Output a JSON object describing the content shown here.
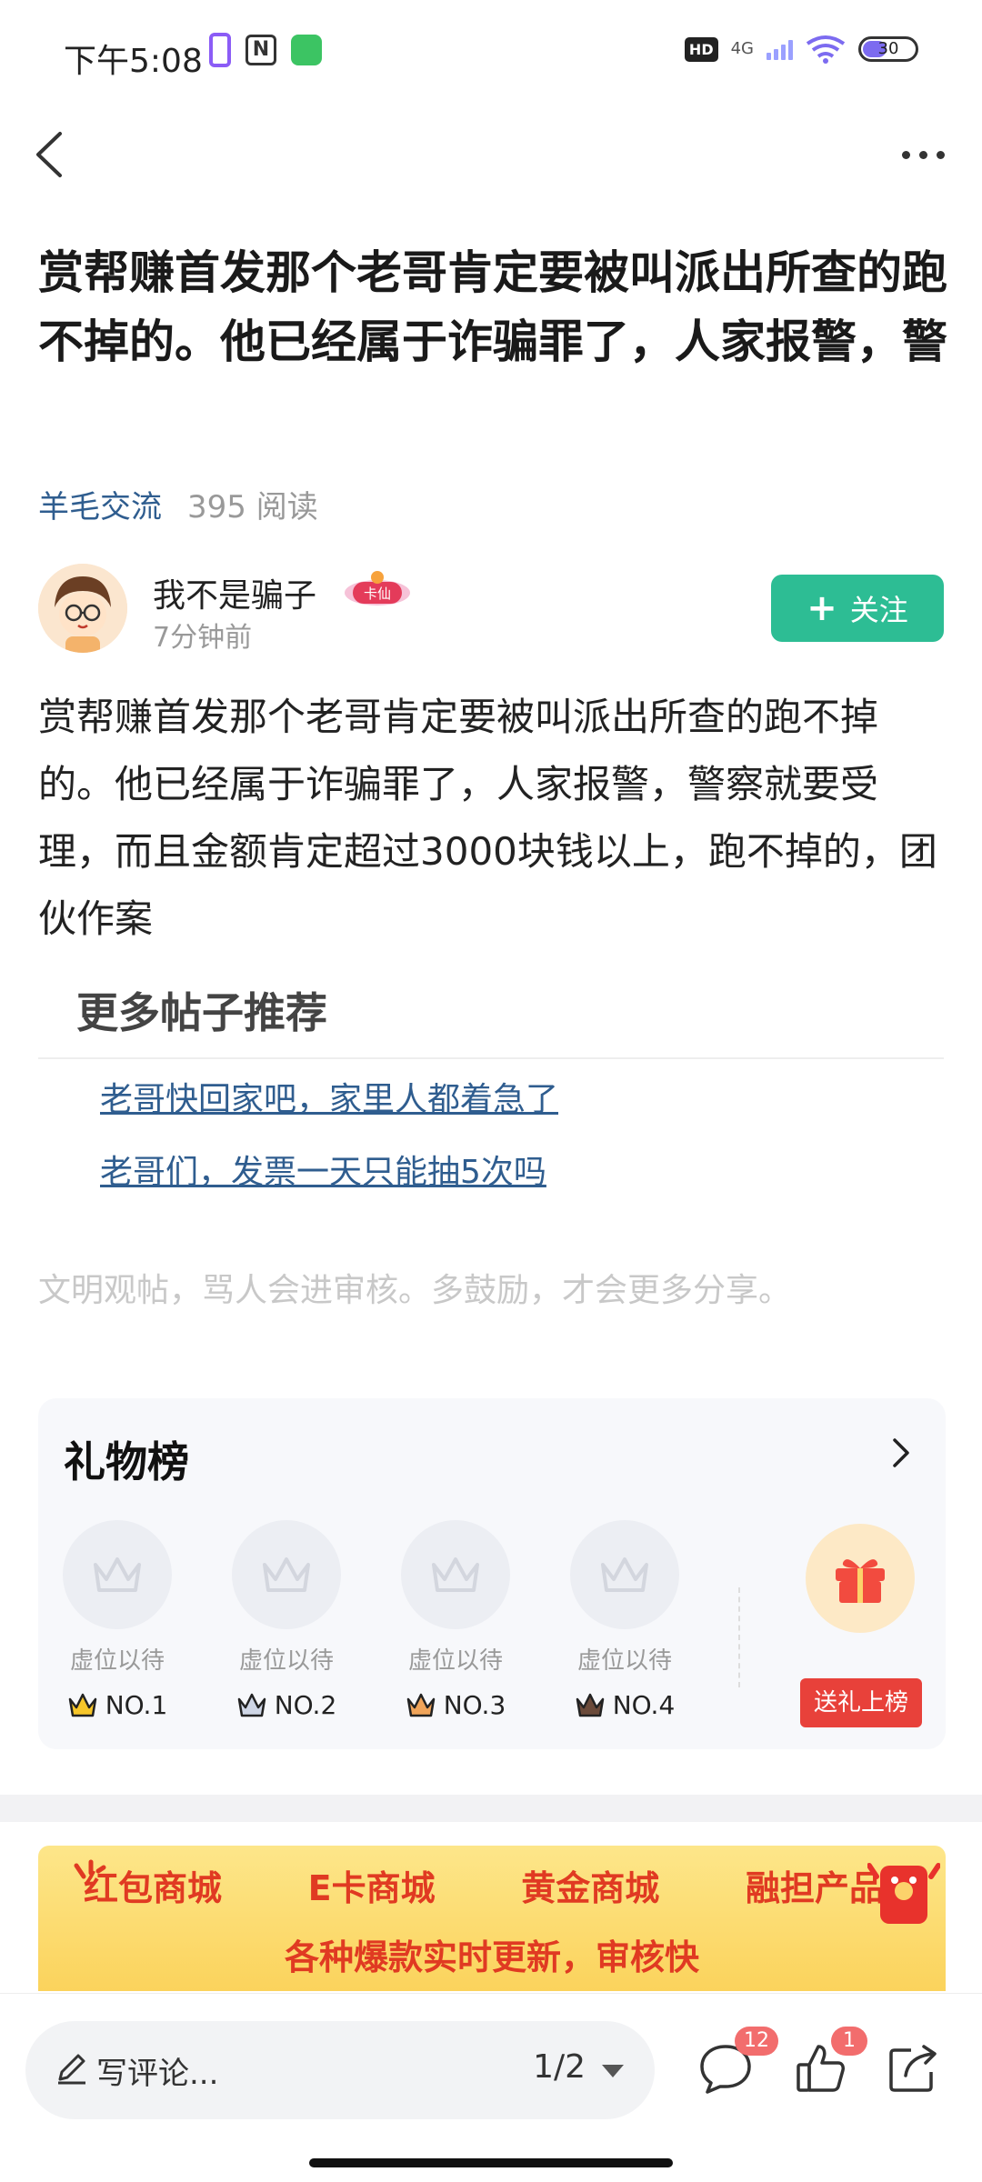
{
  "status_bar": {
    "time": "下午5:08",
    "network": "4G",
    "hd_label": "HD",
    "battery": "30"
  },
  "post": {
    "title": "赏帮赚首发那个老哥肯定要被叫派出所查的跑不掉的。他已经属于诈骗罪了，人家报警，警",
    "category": "羊毛交流",
    "read_count": "395 阅读",
    "body": "赏帮赚首发那个老哥肯定要被叫派出所查的跑不掉的。他已经属于诈骗罪了，人家报警，警察就要受理，而且金额肯定超过3000块钱以上，跑不掉的，团伙作案"
  },
  "author": {
    "name": "我不是骗子",
    "badge": "卡仙",
    "time": "7分钟前",
    "follow_label": "关注"
  },
  "recommend": {
    "title": "更多帖子推荐",
    "links": [
      "老哥快回家吧，家里人都着急了",
      "老哥们，发票一天只能抽5次吗"
    ]
  },
  "civility_note": "文明观帖，骂人会进审核。多鼓励，才会更多分享。",
  "gift_board": {
    "title": "礼物榜",
    "slots": [
      {
        "placeholder": "虚位以待",
        "rank": "NO.1"
      },
      {
        "placeholder": "虚位以待",
        "rank": "NO.2"
      },
      {
        "placeholder": "虚位以待",
        "rank": "NO.3"
      },
      {
        "placeholder": "虚位以待",
        "rank": "NO.4"
      }
    ],
    "send_label": "送礼上榜"
  },
  "banner": {
    "items": [
      "红包商城",
      "E卡商城",
      "黄金商城",
      "融担产品"
    ],
    "subtitle": "各种爆款实时更新，审核快"
  },
  "bottom_bar": {
    "comment_placeholder": "写评论...",
    "pager": "1/2",
    "comment_count": "12",
    "like_count": "1"
  },
  "colors": {
    "accent_green": "#2dbd94",
    "link_blue": "#2f5d8f",
    "red": "#e8413a"
  }
}
